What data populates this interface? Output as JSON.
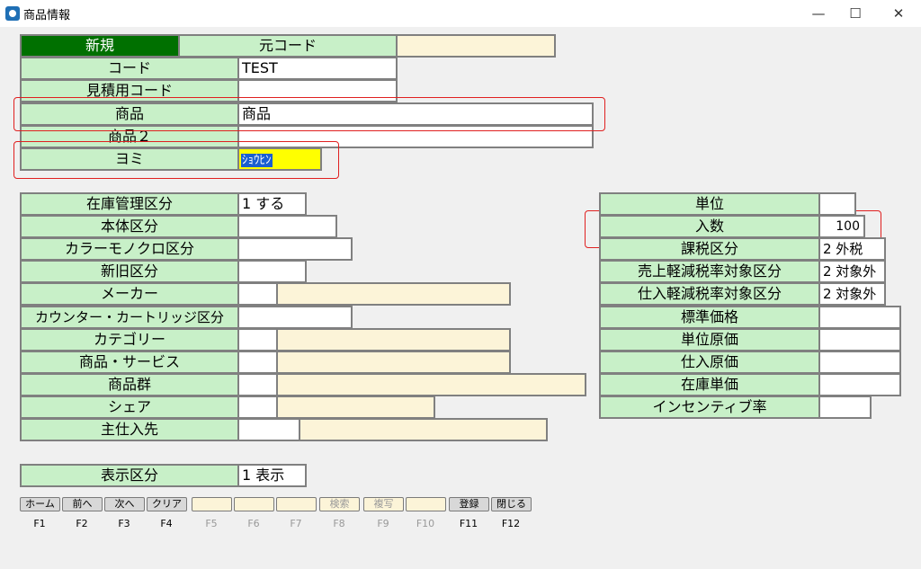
{
  "window": {
    "title": "商品情報",
    "minimize": "—",
    "maximize": "☐",
    "close": "✕"
  },
  "header": {
    "new_label": "新規",
    "original_code_label": "元コード",
    "original_code_value": ""
  },
  "top": {
    "code_label": "コード",
    "code_value": "TEST",
    "estimate_code_label": "見積用コード",
    "estimate_code_value": "",
    "product_label": "商品",
    "product_value": "商品",
    "product2_label": "商品２",
    "product2_value": "",
    "yomi_label": "ヨミ",
    "yomi_value": "ｼｮｳﾋﾝ"
  },
  "left": {
    "inventory_label": "在庫管理区分",
    "inventory_value": "1 する",
    "body_label": "本体区分",
    "body_value": "",
    "color_label": "カラーモノクロ区分",
    "color_value": "",
    "newold_label": "新旧区分",
    "newold_value": "",
    "maker_label": "メーカー",
    "counter_label": "カウンター・カートリッジ区分",
    "counter_value": "",
    "category_label": "カテゴリー",
    "service_label": "商品・サービス",
    "group_label": "商品群",
    "share_label": "シェア",
    "supplier_label": "主仕入先",
    "display_label": "表示区分",
    "display_value": "1 表示"
  },
  "right": {
    "unit_label": "単位",
    "unit_value": "",
    "qty_label": "入数",
    "qty_value": "100",
    "tax_label": "課税区分",
    "tax_value": "2 外税",
    "sales_reduced_label": "売上軽減税率対象区分",
    "sales_reduced_value": "2 対象外",
    "purchase_reduced_label": "仕入軽減税率対象区分",
    "purchase_reduced_value": "2 対象外",
    "std_price_label": "標準価格",
    "std_price_value": "",
    "unit_cost_label": "単位原価",
    "unit_cost_value": "",
    "purchase_cost_label": "仕入原価",
    "purchase_cost_value": "",
    "stock_unit_label": "在庫単価",
    "stock_unit_value": "",
    "incentive_label": "インセンティブ率",
    "incentive_value": ""
  },
  "fkeys": {
    "b1": "ホーム",
    "b2": "前へ",
    "b3": "次へ",
    "b4": "クリア",
    "b5": "",
    "b6": "",
    "b7": "",
    "b8": "検索",
    "b9": "複写",
    "b10": "",
    "b11": "登録",
    "b12": "閉じる",
    "k1": "F1",
    "k2": "F2",
    "k3": "F3",
    "k4": "F4",
    "k5": "F5",
    "k6": "F6",
    "k7": "F7",
    "k8": "F8",
    "k9": "F9",
    "k10": "F10",
    "k11": "F11",
    "k12": "F12"
  }
}
